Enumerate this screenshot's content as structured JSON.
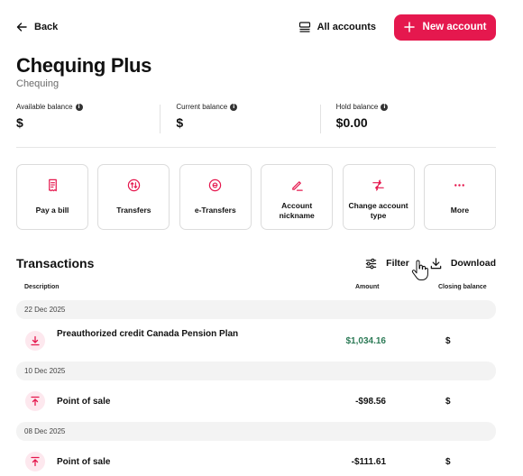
{
  "topbar": {
    "back_label": "Back",
    "all_accounts_label": "All accounts",
    "new_account_label": "New account"
  },
  "account": {
    "name": "Chequing Plus",
    "type": "Chequing"
  },
  "balances": [
    {
      "label": "Available balance",
      "value": "$"
    },
    {
      "label": "Current balance",
      "value": "$"
    },
    {
      "label": "Hold balance",
      "value": "$0.00"
    }
  ],
  "actions": [
    {
      "label": "Pay a bill",
      "icon": "receipt-icon"
    },
    {
      "label": "Transfers",
      "icon": "transfer-arrows-icon"
    },
    {
      "label": "e-Transfers",
      "icon": "e-transfer-icon"
    },
    {
      "label": "Account nickname",
      "icon": "pencil-icon"
    },
    {
      "label": "Change account type",
      "icon": "swap-icon"
    },
    {
      "label": "More",
      "icon": "more-dots-icon"
    }
  ],
  "transactions": {
    "title": "Transactions",
    "filter_label": "Filter",
    "download_label": "Download",
    "columns": {
      "description": "Description",
      "amount": "Amount",
      "closing_balance": "Closing balance"
    },
    "groups": [
      {
        "date": "22 Dec 2025",
        "description": "Preauthorized credit Canada Pension Plan",
        "amount": "$1,034.16",
        "closing": "$",
        "direction": "credit"
      },
      {
        "date": "10 Dec 2025",
        "description": "Point of sale",
        "amount": "-$98.56",
        "closing": "$",
        "direction": "debit"
      },
      {
        "date": "08 Dec 2025",
        "description": "Point of sale",
        "amount": "-$111.61",
        "closing": "$",
        "direction": "debit"
      }
    ]
  },
  "colors": {
    "accent": "#e5184e",
    "credit": "#2c7a56",
    "icon_bg": "#fde8ee"
  }
}
